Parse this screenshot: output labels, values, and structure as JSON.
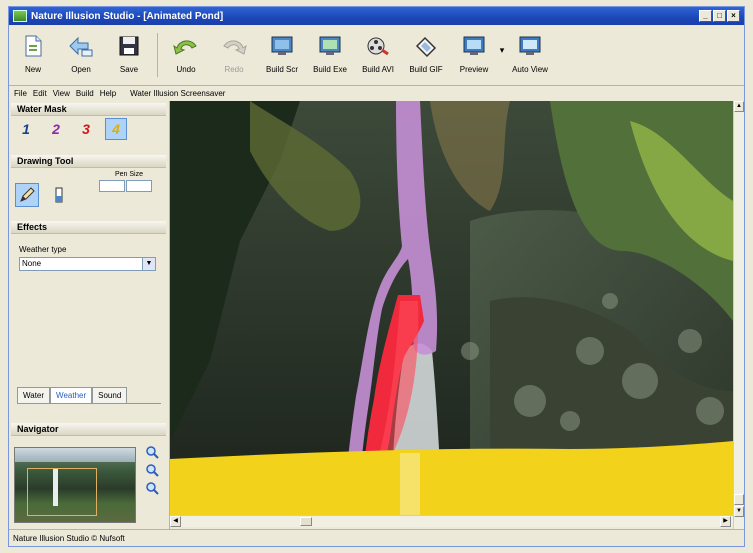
{
  "window": {
    "title": "Nature Illusion Studio - [Animated Pond]",
    "controls": [
      "_",
      "□",
      "×"
    ]
  },
  "toolbar": {
    "new": "New",
    "open": "Open",
    "save": "Save",
    "undo": "Undo",
    "redo": "Redo",
    "build_scr": "Build Scr",
    "build_exe": "Build Exe",
    "build_avi": "Build AVI",
    "build_gif": "Build GIF",
    "preview": "Preview",
    "auto_view": "Auto View"
  },
  "menu": {
    "file": "File",
    "edit": "Edit",
    "view": "View",
    "build": "Build",
    "help": "Help",
    "screensaver_title": "Water Illusion Screensaver"
  },
  "panel": {
    "water_mask": "Water Mask",
    "mask_numbers": [
      "1",
      "2",
      "3",
      "4"
    ],
    "drawing_tool": "Drawing Tool",
    "pen_size": "Pen Size",
    "effects": "Effects",
    "weather_type_label": "Weather type",
    "weather_type_value": "None",
    "tabs": [
      "Water",
      "Weather",
      "Sound"
    ],
    "active_tab": "Weather",
    "navigator": "Navigator"
  },
  "status": {
    "text": "Nature Illusion Studio © Nufsoft"
  },
  "colors": {
    "mask_purple": "#c58fd6",
    "mask_red": "#f02a3c",
    "mask_yellow": "#f2d21a",
    "titlebar": "#1c47b8"
  }
}
